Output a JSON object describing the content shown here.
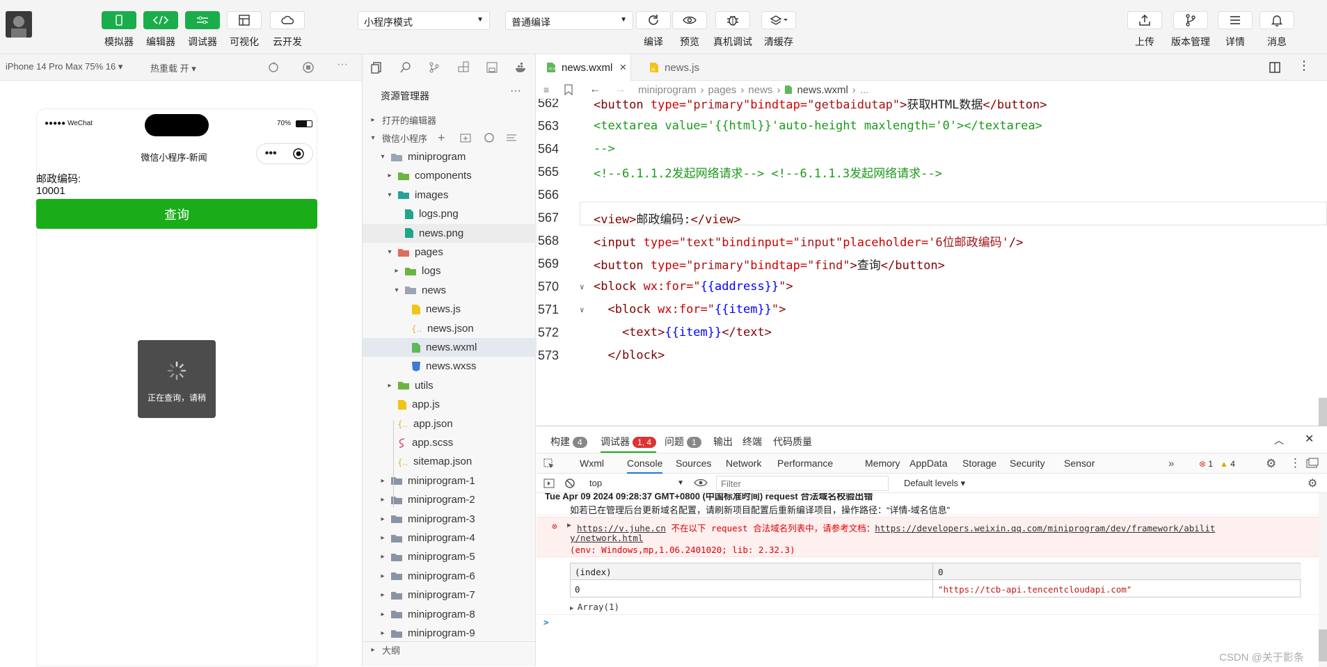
{
  "toolbar": {
    "left_buttons": [
      {
        "label": "模拟器",
        "icon": "phone-icon"
      },
      {
        "label": "编辑器",
        "icon": "code-icon"
      },
      {
        "label": "调试器",
        "icon": "debug-icon"
      },
      {
        "label": "可视化",
        "icon": "layout-icon"
      },
      {
        "label": "云开发",
        "icon": "cloud-icon"
      }
    ],
    "mode_select": "小程序模式",
    "compile_select": "普通编译",
    "mid_buttons": [
      {
        "label": "编译",
        "icon": "refresh-icon"
      },
      {
        "label": "预览",
        "icon": "eye-icon"
      },
      {
        "label": "真机调试",
        "icon": "bug-icon"
      },
      {
        "label": "清缓存",
        "icon": "layers-icon"
      }
    ],
    "right_buttons": [
      {
        "label": "上传",
        "icon": "upload-icon"
      },
      {
        "label": "版本管理",
        "icon": "branch-icon"
      },
      {
        "label": "详情",
        "icon": "menu-icon"
      },
      {
        "label": "消息",
        "icon": "bell-icon"
      }
    ]
  },
  "sim": {
    "device": "iPhone 14 Pro Max 75% 16 ▾",
    "hot_reload": "热重载 开 ▾",
    "status_left": "●●●●● WeChat",
    "battery": "70%",
    "nav_title": "微信小程序-新闻",
    "label": "邮政编码:",
    "value": "10001",
    "button": "查询",
    "toast": "正在查询，请稍"
  },
  "explorer": {
    "title": "资源管理器",
    "open_editors": "打开的编辑器",
    "project": "微信小程序",
    "outline": "大纲",
    "tree": [
      {
        "label": "miniprogram",
        "arrow": "▾",
        "type": "folder"
      },
      {
        "label": "components",
        "arrow": "▸",
        "type": "folder-green"
      },
      {
        "label": "images",
        "arrow": "▾",
        "type": "folder-teal"
      },
      {
        "label": "logs.png",
        "arrow": "",
        "type": "img"
      },
      {
        "label": "news.png",
        "arrow": "",
        "type": "img"
      },
      {
        "label": "pages",
        "arrow": "▾",
        "type": "folder-red"
      },
      {
        "label": "logs",
        "arrow": "▸",
        "type": "folder-green"
      },
      {
        "label": "news",
        "arrow": "▾",
        "type": "folder"
      },
      {
        "label": "news.js",
        "arrow": "",
        "type": "js"
      },
      {
        "label": "news.json",
        "arrow": "",
        "type": "json"
      },
      {
        "label": "news.wxml",
        "arrow": "",
        "type": "wxml"
      },
      {
        "label": "news.wxss",
        "arrow": "",
        "type": "wxss"
      },
      {
        "label": "utils",
        "arrow": "▸",
        "type": "folder-green"
      },
      {
        "label": "app.js",
        "arrow": "",
        "type": "js"
      },
      {
        "label": "app.json",
        "arrow": "",
        "type": "json"
      },
      {
        "label": "app.scss",
        "arrow": "",
        "type": "scss"
      },
      {
        "label": "sitemap.json",
        "arrow": "",
        "type": "json"
      },
      {
        "label": "miniprogram-1",
        "arrow": "▸",
        "type": "folder-gray"
      },
      {
        "label": "miniprogram-2",
        "arrow": "▸",
        "type": "folder-gray"
      },
      {
        "label": "miniprogram-3",
        "arrow": "▸",
        "type": "folder-gray"
      },
      {
        "label": "miniprogram-4",
        "arrow": "▸",
        "type": "folder-gray"
      },
      {
        "label": "miniprogram-5",
        "arrow": "▸",
        "type": "folder-gray"
      },
      {
        "label": "miniprogram-6",
        "arrow": "▸",
        "type": "folder-gray"
      },
      {
        "label": "miniprogram-7",
        "arrow": "▸",
        "type": "folder-gray"
      },
      {
        "label": "miniprogram-8",
        "arrow": "▸",
        "type": "folder-gray"
      },
      {
        "label": "miniprogram-9",
        "arrow": "▸",
        "type": "folder-gray"
      }
    ]
  },
  "editor": {
    "tabs": [
      {
        "label": "news.wxml",
        "close": "×"
      },
      {
        "label": "news.js"
      }
    ],
    "breadcrumb": [
      "miniprogram",
      "pages",
      "news",
      "news.wxml",
      "..."
    ],
    "lines": [
      {
        "n": "562",
        "parts": [
          [
            "tag",
            "<button "
          ],
          [
            "att",
            "type="
          ],
          [
            "str",
            "\"primary\""
          ],
          [
            "att",
            "bindtap="
          ],
          [
            "str",
            "\"getbaidutap\""
          ],
          [
            "tag",
            ">"
          ],
          [
            "ptx",
            "获取HTML数据"
          ],
          [
            "tag",
            "</button>"
          ]
        ]
      },
      {
        "n": "563",
        "parts": [
          [
            "cmt",
            "<textarea value='{{html}}'auto-height maxlength='0'></textarea>"
          ]
        ]
      },
      {
        "n": "564",
        "parts": [
          [
            "cmt",
            "-->"
          ]
        ]
      },
      {
        "n": "565",
        "parts": [
          [
            "cmt",
            "<!--6.1.1.2发起网络请求--> <!--6.1.1.3发起网络请求-->"
          ]
        ]
      },
      {
        "n": "566",
        "parts": []
      },
      {
        "n": "567",
        "parts": [
          [
            "tag",
            "<view>"
          ],
          [
            "ptx",
            "邮政编码:"
          ],
          [
            "tag",
            "</view>"
          ]
        ]
      },
      {
        "n": "568",
        "parts": [
          [
            "tag",
            "<input "
          ],
          [
            "att",
            "type="
          ],
          [
            "str",
            "\"text\""
          ],
          [
            "att",
            "bindinput="
          ],
          [
            "str",
            "\"input\""
          ],
          [
            "att",
            "placeholder="
          ],
          [
            "str",
            "'6位邮政编码'"
          ],
          [
            "tag",
            "/>"
          ]
        ]
      },
      {
        "n": "569",
        "parts": [
          [
            "tag",
            "<button "
          ],
          [
            "att",
            "type="
          ],
          [
            "str",
            "\"primary\""
          ],
          [
            "att",
            "bindtap="
          ],
          [
            "str",
            "\"find\""
          ],
          [
            "tag",
            ">"
          ],
          [
            "ptx",
            "查询"
          ],
          [
            "tag",
            "</button>"
          ]
        ]
      },
      {
        "n": "570",
        "parts": [
          [
            "tag",
            "<block "
          ],
          [
            "att",
            "wx:for="
          ],
          [
            "str",
            "\""
          ],
          [
            "br",
            "{{address}}"
          ],
          [
            "str",
            "\""
          ],
          [
            "tag",
            ">"
          ]
        ]
      },
      {
        "n": "571",
        "parts": [
          [
            "tag",
            "  <block "
          ],
          [
            "att",
            "wx:for="
          ],
          [
            "str",
            "\""
          ],
          [
            "br",
            "{{item}}"
          ],
          [
            "str",
            "\""
          ],
          [
            "tag",
            ">"
          ]
        ]
      },
      {
        "n": "572",
        "parts": [
          [
            "tag",
            "    <text>"
          ],
          [
            "br",
            "{{item}}"
          ],
          [
            "tag",
            "</text>"
          ]
        ]
      },
      {
        "n": "573",
        "parts": [
          [
            "tag",
            "  </block>"
          ]
        ]
      }
    ]
  },
  "devtools": {
    "top_tabs": [
      {
        "label": "构建",
        "badge": "4"
      },
      {
        "label": "调试器",
        "badge": "1, 4"
      },
      {
        "label": "问题",
        "badge": "1"
      },
      {
        "label": "输出"
      },
      {
        "label": "终端"
      },
      {
        "label": "代码质量"
      }
    ],
    "panel_tabs": [
      "Wxml",
      "Console",
      "Sources",
      "Network",
      "Performance",
      "Memory",
      "AppData",
      "Storage",
      "Security",
      "Sensor"
    ],
    "errors": "1",
    "warnings": "4",
    "context": "top",
    "filter_placeholder": "Filter",
    "levels": "Default levels ▾",
    "log_header": "Tue Apr 09 2024 09:28:37 GMT+0800 (中国标准时间) request 合法域名校验出错",
    "log_info": "如若已在管理后台更新域名配置，请刷新项目配置后重新编译项目，操作路径：“详情-域名信息”",
    "err_url": "https://v.juhe.cn",
    "err_text": " 不在以下 request 合法域名列表中，请参考文档：",
    "err_doc1": "https://developers.weixin.qq.com/miniprogram/dev/framework/abilit",
    "err_doc2": "y/network.html",
    "err_env": "(env: Windows,mp,1.06.2401020; lib: 2.32.3)",
    "table_head": [
      "(index)",
      "0"
    ],
    "table_row": [
      "0",
      "\"https://tcb-api.tencentcloudapi.com\""
    ],
    "array": "Array(1)",
    "prompt": ">"
  },
  "watermark": "CSDN @关于影条"
}
